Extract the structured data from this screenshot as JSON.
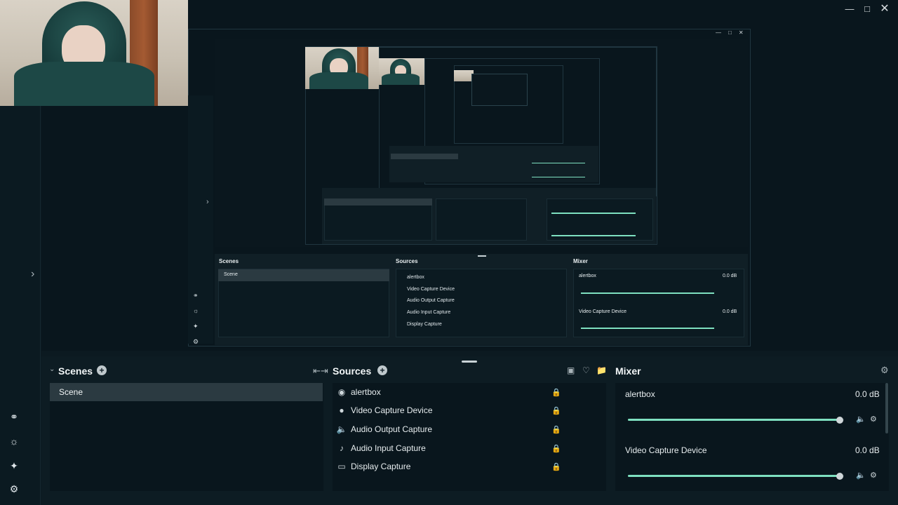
{
  "window": {
    "minimize_icon": "minimize-icon",
    "maximize_icon": "maximize-icon",
    "close_icon": "close-icon"
  },
  "left_rail": {
    "items": [
      {
        "name": "studio-mode-icon"
      },
      {
        "name": "themes-icon"
      },
      {
        "name": "magic-icon"
      },
      {
        "name": "settings-icon"
      }
    ]
  },
  "docks": {
    "scenes": {
      "title": "Scenes",
      "items": [
        "Scene"
      ]
    },
    "sources": {
      "title": "Sources",
      "items": [
        {
          "label": "alertbox",
          "icon": "globe-icon"
        },
        {
          "label": "Video Capture Device",
          "icon": "webcam-icon"
        },
        {
          "label": "Audio Output Capture",
          "icon": "speaker-icon"
        },
        {
          "label": "Audio Input Capture",
          "icon": "microphone-icon"
        },
        {
          "label": "Display Capture",
          "icon": "monitor-icon"
        }
      ]
    },
    "mixer": {
      "title": "Mixer",
      "channels": [
        {
          "name": "alertbox",
          "level": "0.0 dB",
          "volume_fraction": 0.98
        },
        {
          "name": "Video Capture Device",
          "level": "0.0 dB",
          "volume_fraction": 0.98
        }
      ]
    }
  },
  "preview": {
    "scenes_title": "Scenes",
    "sources_title": "Sources",
    "mixer_title": "Mixer",
    "scene_item": "Scene",
    "sources": [
      "alertbox",
      "Video Capture Device",
      "Audio Output Capture",
      "Audio Input Capture",
      "Display Capture"
    ],
    "mixer": [
      {
        "name": "alertbox",
        "level": "0.0 dB"
      },
      {
        "name": "Video Capture Device",
        "level": "0.0 dB"
      }
    ]
  },
  "colors": {
    "accent": "#7ee0c0",
    "background": "#09161d",
    "panel": "#0d1c23"
  }
}
